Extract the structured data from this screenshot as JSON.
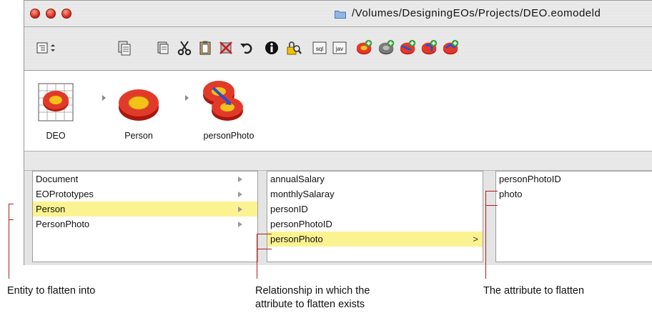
{
  "window": {
    "title": "/Volumes/DesigningEOs/Projects/DEO.eomodeld"
  },
  "toolbar": {
    "icons": [
      "list-view-icon",
      "copy-icon",
      "paste-icon",
      "cut-icon",
      "clipboard-icon",
      "delete-icon",
      "undo-icon",
      "info-icon",
      "lock-search-icon",
      "sql-icon",
      "java-icon",
      "add-entity-icon",
      "add-attribute-icon",
      "add-relationship-icon",
      "add-fetch-spec-icon",
      "add-stored-proc-icon"
    ],
    "sql_label": "sql",
    "java_label": "jav"
  },
  "path": {
    "items": [
      {
        "label": "DEO"
      },
      {
        "label": "Person"
      },
      {
        "label": "personPhoto"
      }
    ]
  },
  "browser": {
    "column1": [
      "Document",
      "EOPrototypes",
      "Person",
      "PersonPhoto"
    ],
    "column2": [
      "annualSalary",
      "monthlySalaray",
      "personID",
      "personPhotoID",
      "personPhoto"
    ],
    "column3": [
      "personPhotoID",
      "photo"
    ]
  },
  "callouts": {
    "entity": "Entity to flatten into",
    "relationship_line1": "Relationship in which the",
    "relationship_line2": "attribute to flatten exists",
    "attribute": "The attribute to flatten"
  },
  "colors": {
    "selection": "#fbf391",
    "callout_line": "#b21d1d"
  }
}
